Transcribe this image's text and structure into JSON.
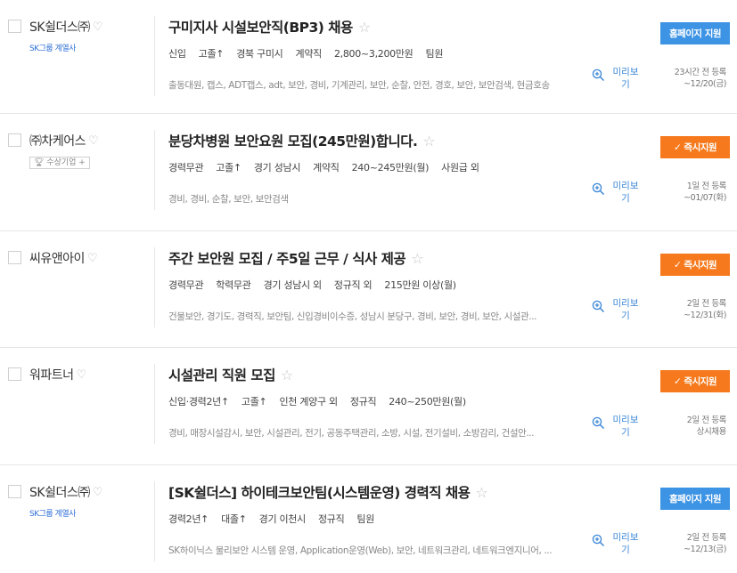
{
  "jobs": [
    {
      "company": "SK쉴더스㈜",
      "company_sub": "SK그룹 계열사",
      "badge": "",
      "title": "구미지사 시설보안직(BP3) 채용",
      "conditions": [
        "신입",
        "고졸↑",
        "경북 구미시",
        "계약직",
        "2,800~3,200만원",
        "팀원"
      ],
      "tags": "출동대원, 캡스, ADT캡스, adt, 보안, 경비, 기계관리, 보안, 순찰, 안전, 경호, 보안, 보안검색, 현금호송",
      "preview_label": "미리보기",
      "button_label": "홈페이지 지원",
      "button_type": "home",
      "posted": "23시간 전 등록",
      "deadline": "~12/20(금)"
    },
    {
      "company": "㈜차케어스",
      "company_sub": "",
      "badge": "수상기업 +",
      "title": "분당차병원 보안요원 모집(245만원)합니다.",
      "conditions": [
        "경력무관",
        "고졸↑",
        "경기 성남시",
        "계약직",
        "240~245만원(월)",
        "사원급 외"
      ],
      "tags": "경비, 경비, 순찰, 보안, 보안검색",
      "preview_label": "미리보기",
      "button_label": "즉시지원",
      "button_type": "now",
      "posted": "1일 전 등록",
      "deadline": "~01/07(화)"
    },
    {
      "company": "씨유앤아이",
      "company_sub": "",
      "badge": "",
      "title": "주간 보안원 모집 / 주5일 근무 / 식사 제공",
      "conditions": [
        "경력무관",
        "학력무관",
        "경기 성남시 외",
        "정규직 외",
        "215만원 이상(월)"
      ],
      "tags": "건물보안, 경기도, 경력직, 보안팀, 신입경비이수증, 성남시 분당구, 경비, 보안, 경비, 보안, 시설관...",
      "preview_label": "미리보기",
      "button_label": "즉시지원",
      "button_type": "now",
      "posted": "2일 전 등록",
      "deadline": "~12/31(화)"
    },
    {
      "company": "워파트너",
      "company_sub": "",
      "badge": "",
      "title": "시설관리 직원 모집",
      "conditions": [
        "신입·경력2년↑",
        "고졸↑",
        "인천 계양구 외",
        "정규직",
        "240~250만원(월)"
      ],
      "tags": "경비, 매장시설감시, 보안, 시설관리, 전기, 공동주택관리, 소방, 시설, 전기설비, 소방감리, 건설안...",
      "preview_label": "미리보기",
      "button_label": "즉시지원",
      "button_type": "now",
      "posted": "2일 전 등록",
      "deadline": "상시채용"
    },
    {
      "company": "SK쉴더스㈜",
      "company_sub": "SK그룹 계열사",
      "badge": "",
      "title": "[SK쉴더스] 하이테크보안팀(시스템운영) 경력직 채용",
      "conditions": [
        "경력2년↑",
        "대졸↑",
        "경기 이천시",
        "정규직",
        "팀원"
      ],
      "tags": "SK하이닉스 물리보안 시스템 운영, Application운영(Web), 보안, 네트워크관리, 네트워크엔지니어, ...",
      "preview_label": "미리보기",
      "button_label": "홈페이지 지원",
      "button_type": "home",
      "posted": "2일 전 등록",
      "deadline": "~12/13(금)"
    }
  ]
}
